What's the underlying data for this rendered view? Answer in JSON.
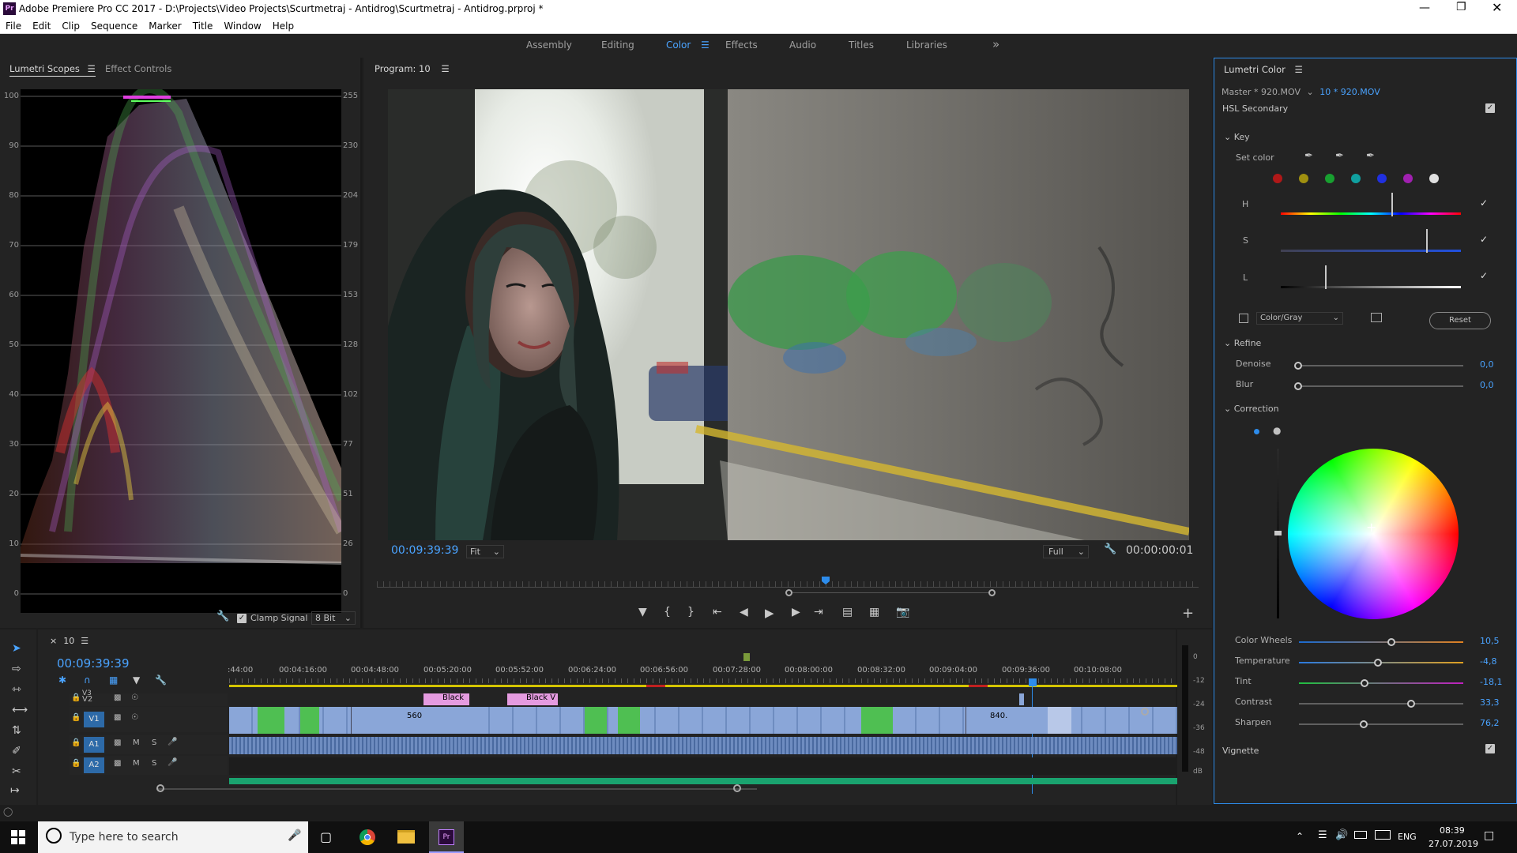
{
  "app": {
    "title": "Adobe Premiere Pro CC 2017 - D:\\Projects\\Video Projects\\Scurtmetraj - Antidrog\\Scurtmetraj - Antidrog.prproj *",
    "logo": "Pr"
  },
  "menu": [
    "File",
    "Edit",
    "Clip",
    "Sequence",
    "Marker",
    "Title",
    "Window",
    "Help"
  ],
  "workspaces": {
    "items": [
      "Assembly",
      "Editing",
      "Color",
      "Effects",
      "Audio",
      "Titles",
      "Libraries"
    ],
    "active": "Color",
    "more": "»"
  },
  "scopes": {
    "tab1": "Lumetri Scopes",
    "tab2": "Effect Controls",
    "left_scale": [
      "100",
      "90",
      "80",
      "70",
      "60",
      "50",
      "40",
      "30",
      "20",
      "10",
      "0"
    ],
    "right_scale": [
      "255",
      "230",
      "204",
      "179",
      "153",
      "128",
      "102",
      "77",
      "51",
      "26",
      "0"
    ],
    "clamp_label": "Clamp Signal",
    "bit_depth": "8 Bit"
  },
  "program": {
    "title": "Program: 10",
    "timecode": "00:09:39:39",
    "fit": "Fit",
    "quality": "Full",
    "duration": "00:00:00:01"
  },
  "timeline": {
    "seq_name": "10",
    "timecode": "00:09:39:39",
    "ruler": [
      ":44:00",
      "00:04:16:00",
      "00:04:48:00",
      "00:05:20:00",
      "00:05:52:00",
      "00:06:24:00",
      "00:06:56:00",
      "00:07:28:00",
      "00:08:00:00",
      "00:08:32:00",
      "00:09:04:00",
      "00:09:36:00",
      "00:10:08:00"
    ],
    "tracks": {
      "v3": "V3",
      "v2": "V2",
      "v1": "V1",
      "a1": "A1",
      "a2": "A2",
      "m": "M",
      "s": "S"
    },
    "clip_labels": {
      "black1": "Black",
      "black2": "Black V",
      "n560": "560",
      "n840": "840."
    }
  },
  "meter": {
    "scale": [
      "0",
      "-12",
      "-24",
      "-36",
      "-48",
      "dB"
    ]
  },
  "lumetri": {
    "title": "Lumetri Color",
    "master": "Master * 920.MOV",
    "clip": "10 * 920.MOV",
    "section": "HSL Secondary",
    "key": "Key",
    "set_color": "Set color",
    "h": "H",
    "s": "S",
    "l": "L",
    "colorgray": "Color/Gray",
    "reset": "Reset",
    "refine": "Refine",
    "denoise": "Denoise",
    "denoise_val": "0,0",
    "blur": "Blur",
    "blur_val": "0,0",
    "correction": "Correction",
    "adjust": [
      {
        "label": "Color Wheels",
        "value": "10,5",
        "pos": 0.5
      },
      {
        "label": "Temperature",
        "value": "-4,8",
        "pos": 0.47
      },
      {
        "label": "Tint",
        "value": "-18,1",
        "pos": 0.41
      },
      {
        "label": "Contrast",
        "value": "33,3",
        "pos": 0.66
      },
      {
        "label": "Sharpen",
        "value": "76,2",
        "pos": 0.38
      }
    ],
    "vignette": "Vignette"
  },
  "taskbar": {
    "search": "Type here to search",
    "lang": "ENG",
    "time": "08:39",
    "date": "27.07.2019"
  },
  "colors": {
    "accent": "#2d8ceb",
    "clip_blue": "#8aa6d8",
    "clip_green": "#4fbf52",
    "audio_green": "#1aa36f",
    "pink": "#e59be0"
  }
}
